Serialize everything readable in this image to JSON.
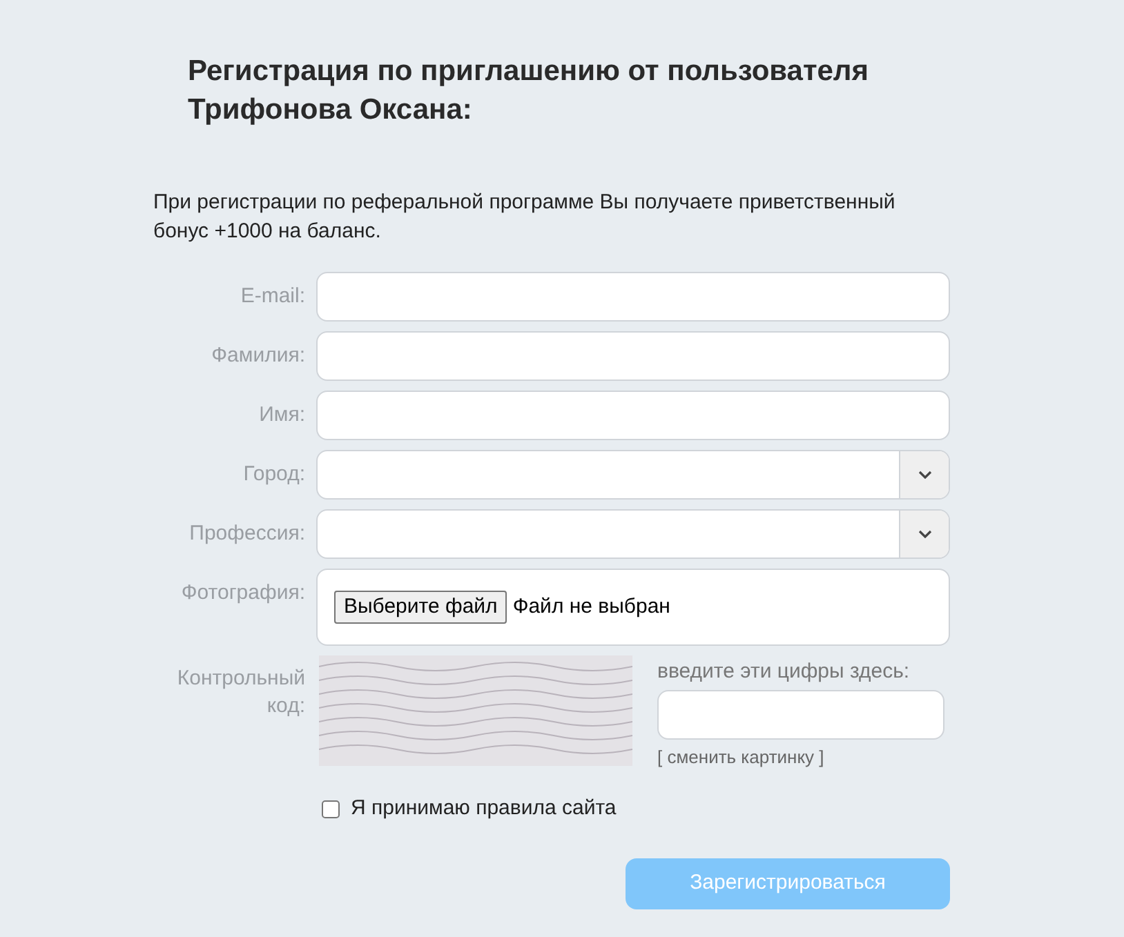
{
  "heading": "Регистрация по приглашению от пользователя Трифонова Оксана:",
  "intro": "При регистрации по реферальной программе Вы получаете приветственный бонус +1000 на баланс.",
  "fields": [
    {
      "kind": "text",
      "label": "E-mail:"
    },
    {
      "kind": "text",
      "label": "Фамилия:"
    },
    {
      "kind": "text",
      "label": "Имя:"
    },
    {
      "kind": "select",
      "label": "Город:"
    },
    {
      "kind": "select",
      "label": "Профессия:"
    },
    {
      "kind": "file",
      "label": "Фотография:",
      "button": "Выберите файл",
      "status": "Файл не выбран"
    }
  ],
  "captcha": {
    "label": "Контрольный код:",
    "prompt": "введите эти цифры здесь:",
    "refresh_link": "[ сменить картинку ]"
  },
  "agreement": {
    "label": "Я принимаю правила сайта",
    "checked": false
  },
  "submit": {
    "label": "Зарегистрироваться",
    "disabled": true
  }
}
